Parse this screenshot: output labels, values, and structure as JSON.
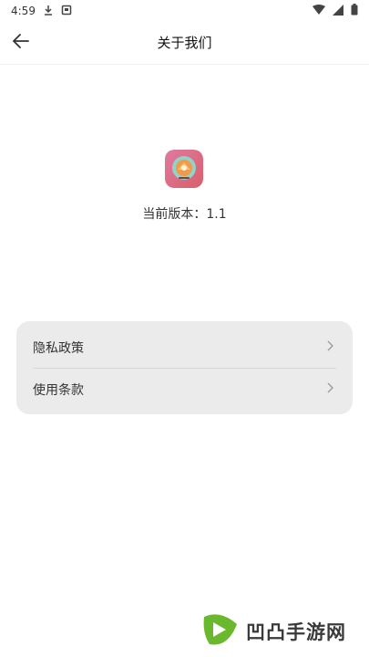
{
  "status_bar": {
    "time": "4:59"
  },
  "header": {
    "title": "关于我们"
  },
  "app": {
    "version_text": "当前版本：1.1"
  },
  "menu": {
    "items": [
      {
        "label": "隐私政策"
      },
      {
        "label": "使用条款"
      }
    ]
  },
  "watermark": {
    "text": "凹凸手游网"
  }
}
